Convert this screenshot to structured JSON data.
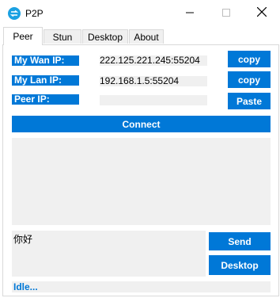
{
  "window": {
    "title": "P2P",
    "minimize_icon": "minimize-icon",
    "maximize_icon": "maximize-icon",
    "close_icon": "close-icon"
  },
  "tabs": [
    {
      "label": "Peer",
      "active": true
    },
    {
      "label": "Stun",
      "active": false
    },
    {
      "label": "Desktop",
      "active": false
    },
    {
      "label": "About",
      "active": false
    }
  ],
  "peer": {
    "wan_label": "My Wan IP:",
    "wan_value": "222.125.221.245:55204",
    "wan_copy": "copy",
    "lan_label": "My Lan IP:",
    "lan_value": "192.168.1.5:55204",
    "lan_copy": "copy",
    "peer_label": "Peer IP:",
    "peer_value": "",
    "paste": "Paste",
    "connect": "Connect",
    "log_text": "",
    "message": "你好",
    "send": "Send",
    "desktop": "Desktop",
    "status": "Idle..."
  },
  "colors": {
    "accent": "#0078d7",
    "field_bg": "#f0f0f0",
    "window_bg": "#ffffff"
  }
}
